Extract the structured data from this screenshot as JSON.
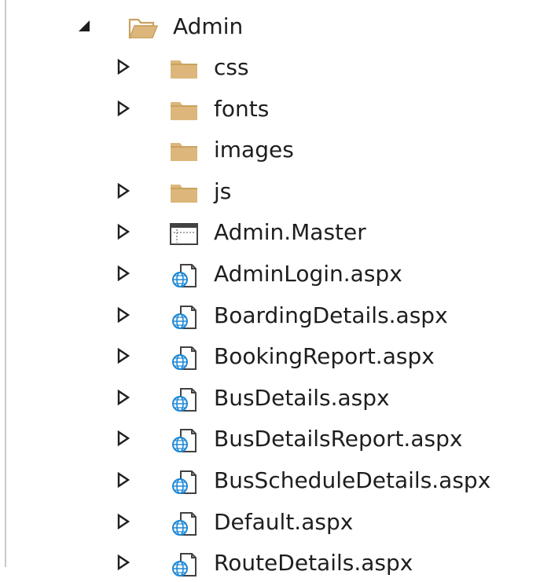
{
  "tree": {
    "root": {
      "label": "Admin",
      "icon": "folder-open-icon",
      "expanded": true
    },
    "children": [
      {
        "label": "css",
        "icon": "folder-icon",
        "expander": "collapsed"
      },
      {
        "label": "fonts",
        "icon": "folder-icon",
        "expander": "collapsed"
      },
      {
        "label": "images",
        "icon": "folder-icon",
        "expander": "none"
      },
      {
        "label": "js",
        "icon": "folder-icon",
        "expander": "collapsed"
      },
      {
        "label": "Admin.Master",
        "icon": "master-page-icon",
        "expander": "collapsed"
      },
      {
        "label": "AdminLogin.aspx",
        "icon": "aspx-file-icon",
        "expander": "collapsed"
      },
      {
        "label": "BoardingDetails.aspx",
        "icon": "aspx-file-icon",
        "expander": "collapsed"
      },
      {
        "label": "BookingReport.aspx",
        "icon": "aspx-file-icon",
        "expander": "collapsed"
      },
      {
        "label": "BusDetails.aspx",
        "icon": "aspx-file-icon",
        "expander": "collapsed"
      },
      {
        "label": "BusDetailsReport.aspx",
        "icon": "aspx-file-icon",
        "expander": "collapsed"
      },
      {
        "label": "BusScheduleDetails.aspx",
        "icon": "aspx-file-icon",
        "expander": "collapsed"
      },
      {
        "label": "Default.aspx",
        "icon": "aspx-file-icon",
        "expander": "collapsed"
      },
      {
        "label": "RouteDetails.aspx",
        "icon": "aspx-file-icon",
        "expander": "collapsed"
      }
    ]
  },
  "colors": {
    "folder": "#dcb67a",
    "folder_dark": "#c9a25f",
    "globe": "#1e88d6",
    "text": "#1e1e1e",
    "arrow": "#1e1e1e"
  }
}
